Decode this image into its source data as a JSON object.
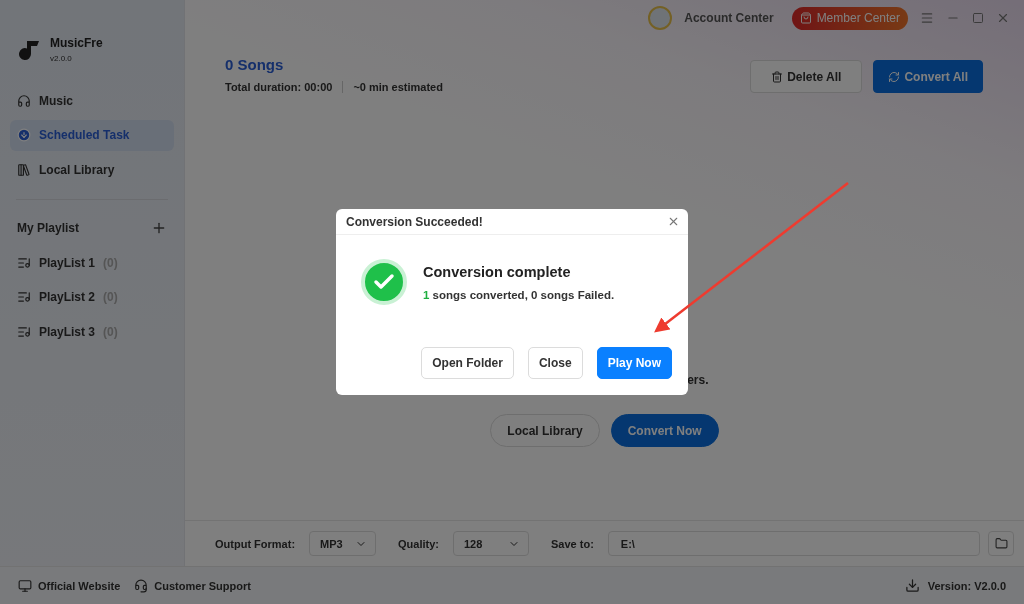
{
  "app": {
    "name": "MusicFre",
    "version": "v2.0.0"
  },
  "nav": [
    {
      "label": "Music",
      "selected": false
    },
    {
      "label": "Scheduled Task",
      "selected": true
    },
    {
      "label": "Local Library",
      "selected": false
    }
  ],
  "playlist_section": {
    "title": "My Playlist"
  },
  "playlists": [
    {
      "name": "PlayList 1",
      "count": "(0)"
    },
    {
      "name": "PlayList 2",
      "count": "(0)"
    },
    {
      "name": "PlayList 3",
      "count": "(0)"
    }
  ],
  "topbar": {
    "account": "Account Center",
    "member": "Member Center"
  },
  "header": {
    "title": "0 Songs",
    "duration": "Total duration: 00:00",
    "estimate": "~0 min estimated"
  },
  "header_buttons": [
    {
      "label": "Delete All",
      "kind": "secondary"
    },
    {
      "label": "Convert All",
      "kind": "primary"
    }
  ],
  "empty_state": {
    "hint": "ers.",
    "buttons": [
      {
        "label": "Local Library",
        "kind": "secondary"
      },
      {
        "label": "Convert Now",
        "kind": "primary"
      }
    ]
  },
  "settings": {
    "format_label": "Output Format:",
    "format": "MP3",
    "quality_label": "Quality:",
    "quality": "128",
    "save_label": "Save to:",
    "save_path": "E:\\"
  },
  "footer": {
    "links": [
      "Official Website",
      "Customer Support"
    ],
    "version": "Version: V2.0.0"
  },
  "dialog": {
    "title": "Conversion Succeeded!",
    "heading": "Conversion complete",
    "converted_count": "1",
    "message": "songs converted, 0 songs Failed.",
    "buttons": [
      {
        "label": "Open Folder",
        "kind": "secondary"
      },
      {
        "label": "Close",
        "kind": "secondary"
      },
      {
        "label": "Play Now",
        "kind": "primary"
      }
    ]
  }
}
